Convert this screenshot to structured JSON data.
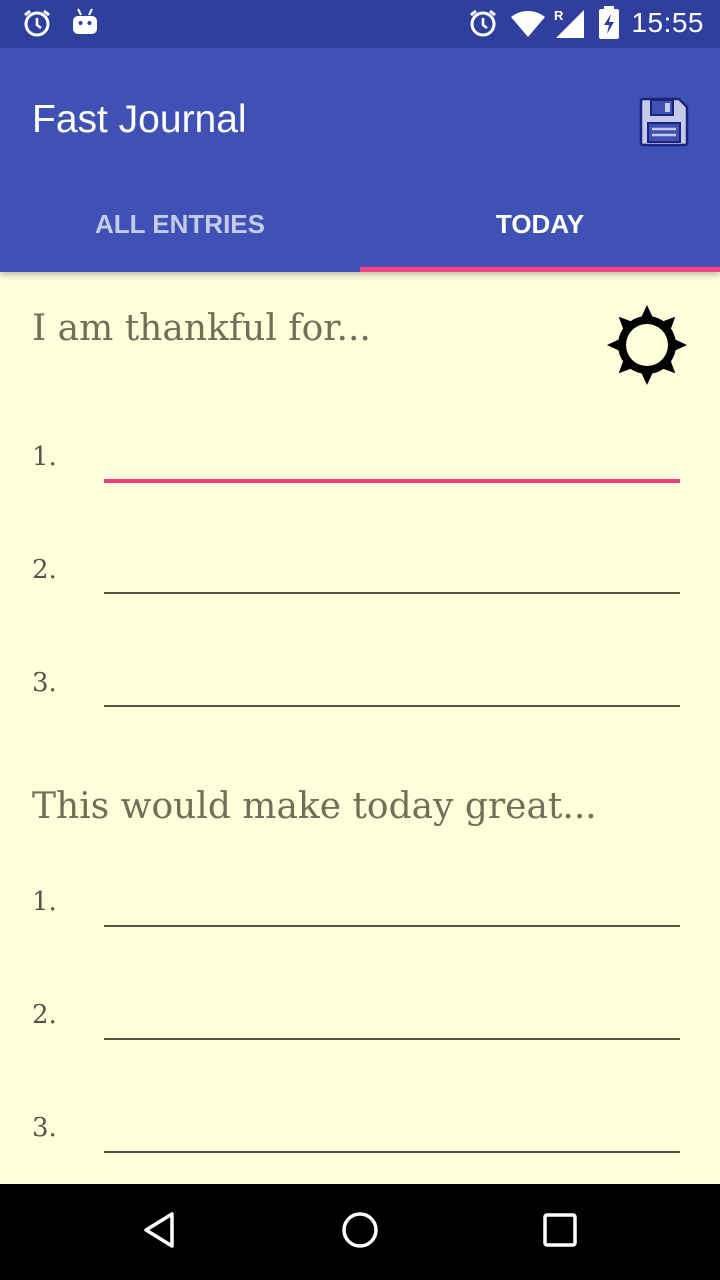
{
  "status_bar": {
    "time": "15:55",
    "icons": [
      "alarm-icon",
      "android-icon",
      "alarm-icon",
      "wifi-icon",
      "signal-roaming-icon",
      "battery-charging-icon"
    ]
  },
  "app_bar": {
    "title": "Fast Journal",
    "save_icon": "floppy-disk-icon"
  },
  "tabs": [
    {
      "label": "ALL ENTRIES",
      "active": false
    },
    {
      "label": "TODAY",
      "active": true
    }
  ],
  "thankful": {
    "title": "I am thankful for...",
    "icon": "sun-icon",
    "items": [
      {
        "number": "1.",
        "value": ""
      },
      {
        "number": "2.",
        "value": ""
      },
      {
        "number": "3.",
        "value": ""
      }
    ]
  },
  "great": {
    "title": "This would make today great...",
    "items": [
      {
        "number": "1.",
        "value": ""
      },
      {
        "number": "2.",
        "value": ""
      },
      {
        "number": "3.",
        "value": ""
      }
    ]
  },
  "nav": {
    "icons": [
      "back-icon",
      "home-icon",
      "recents-icon"
    ]
  },
  "colors": {
    "primary": "#3f51b5",
    "primary_dark": "#2f3f9e",
    "accent": "#ff4081",
    "background": "#ffffdb"
  }
}
